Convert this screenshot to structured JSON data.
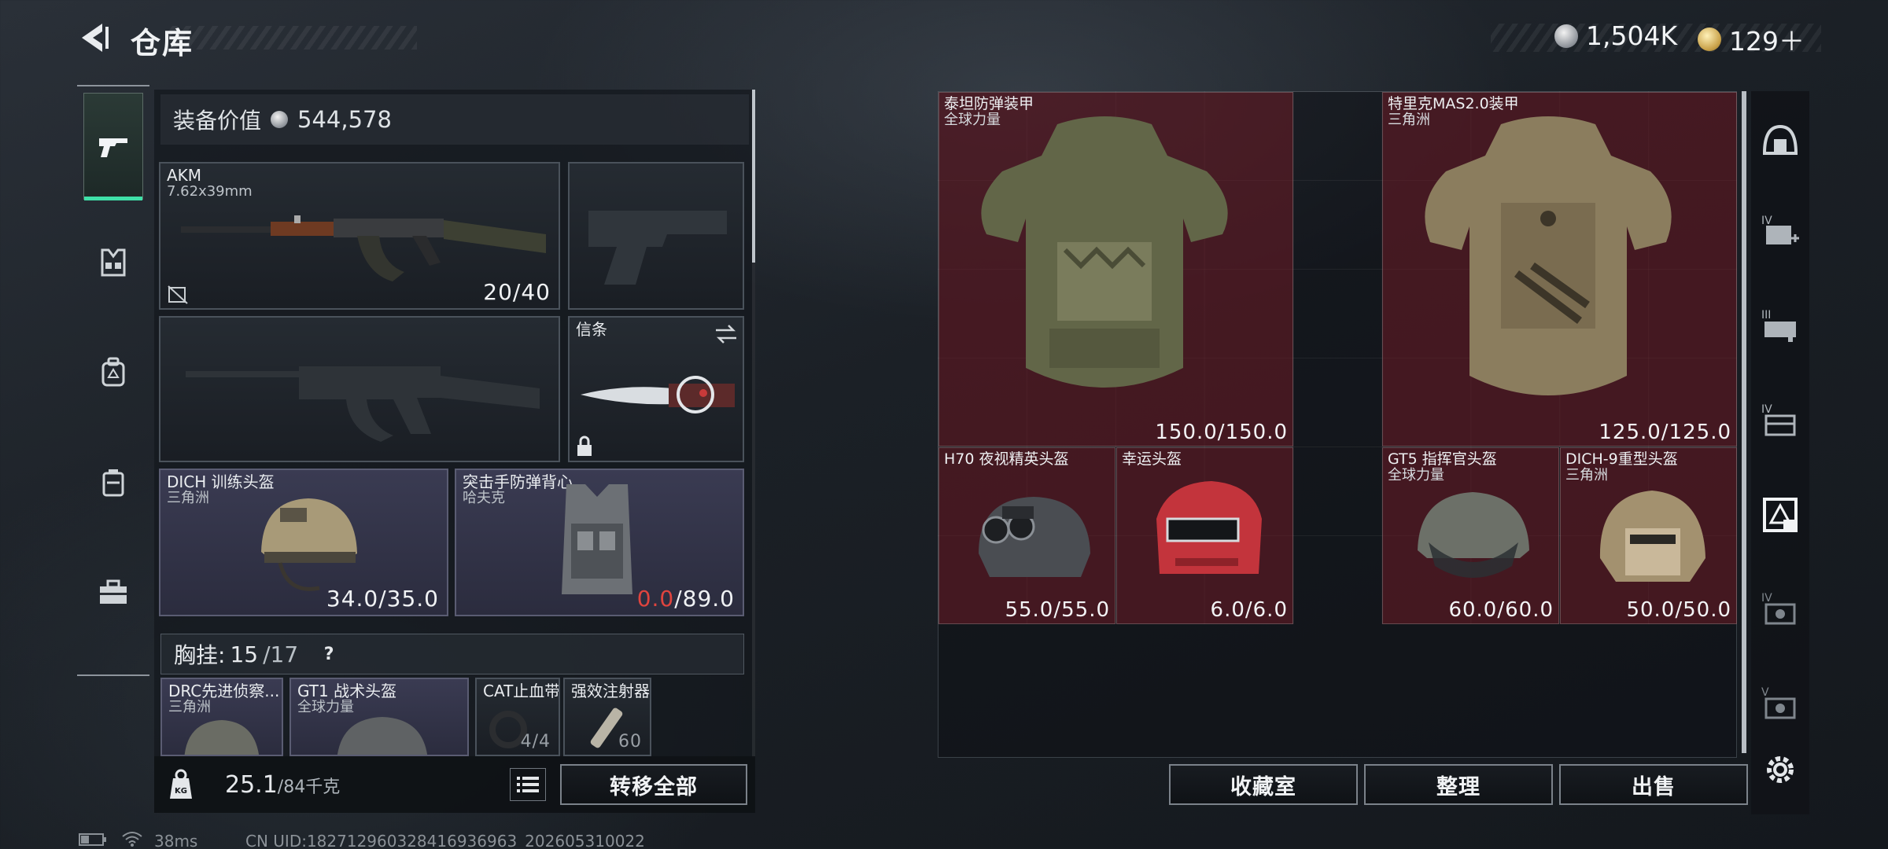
{
  "header": {
    "title": "仓库"
  },
  "currency": {
    "silver_amount": "1,504K",
    "gold_amount": "129＋"
  },
  "left_panel": {
    "value_label": "装备价值",
    "value_amount": "544,578",
    "categories": [
      {
        "icon": "pistol-icon",
        "active": true
      },
      {
        "icon": "tactical-rig-icon",
        "active": false
      },
      {
        "icon": "backpack-icon",
        "active": false
      },
      {
        "icon": "pouch-icon",
        "active": false
      },
      {
        "icon": "toolbox-icon",
        "active": false
      }
    ],
    "slots": {
      "primary": {
        "name": "AKM",
        "sub": "7.62x39mm",
        "durability": "20/40"
      },
      "melee": {
        "name": "信条"
      },
      "helmet": {
        "name": "DICH 训练头盔",
        "sub": "三角洲",
        "durability": "34.0/35.0"
      },
      "armor": {
        "name": "突击手防弹背心",
        "sub": "哈夫克",
        "durability_current": "0.0",
        "durability_max": "/89.0"
      }
    },
    "chest_rig": {
      "label": "胸挂:",
      "current": "15",
      "max": "/17",
      "help": "?"
    },
    "rig_items": [
      {
        "name": "DRC先进侦察...",
        "sub": "三角洲"
      },
      {
        "name": "GT1 战术头盔",
        "sub": "全球力量"
      },
      {
        "name": "CAT止血带",
        "count": "4/4"
      },
      {
        "name": "强效注射器",
        "count": "60"
      }
    ],
    "weight": {
      "current": "25.1",
      "max": "/84千克"
    },
    "transfer_all": "转移全部"
  },
  "stash": {
    "items": [
      {
        "name": "泰坦防弹装甲",
        "sub": "全球力量",
        "durability": "150.0/150.0"
      },
      {
        "name": "特里克MAS2.0装甲",
        "sub": "三角洲",
        "durability": "125.0/125.0"
      },
      {
        "name": "H70 夜视精英头盔",
        "sub": "",
        "durability": "55.0/55.0"
      },
      {
        "name": "幸运头盔",
        "sub": "",
        "durability": "6.0/6.0"
      },
      {
        "name": "GT5 指挥官头盔",
        "sub": "全球力量",
        "durability": "60.0/60.0"
      },
      {
        "name": "DICH-9重型头盔",
        "sub": "三角洲",
        "durability": "50.0/50.0"
      }
    ],
    "buttons": {
      "collection": "收藏室",
      "sort": "整理",
      "sell": "出售"
    }
  },
  "filters": [
    {
      "icon": "helmet-filter-icon",
      "roman": ""
    },
    {
      "icon": "medkit-filter-icon",
      "roman": "IV"
    },
    {
      "icon": "rig-filter-icon",
      "roman": "III"
    },
    {
      "icon": "case-filter-icon",
      "roman": "IV"
    },
    {
      "icon": "armor-filter-icon",
      "roman": ""
    },
    {
      "icon": "safe-filter-icon",
      "roman": "IV"
    },
    {
      "icon": "safe-filter-icon",
      "roman": "V"
    }
  ],
  "status": {
    "ping": "38ms",
    "uid": "CN UID:18271296032841693​6963_202605310022"
  }
}
